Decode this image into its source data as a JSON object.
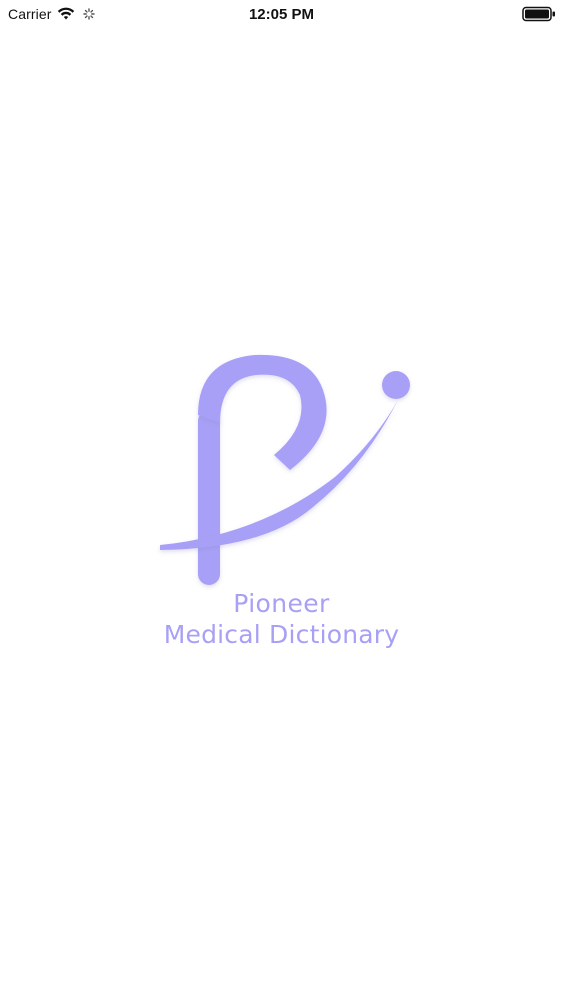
{
  "status_bar": {
    "carrier": "Carrier",
    "time": "12:05 PM",
    "icons": [
      "wifi-icon",
      "loading-icon",
      "battery-icon"
    ]
  },
  "splash": {
    "logo_icon": "pioneer-p-logo-icon",
    "app_name_line1": "Pioneer",
    "app_name_line2": "Medical Dictionary",
    "brand_color": "#a7a0f6"
  }
}
